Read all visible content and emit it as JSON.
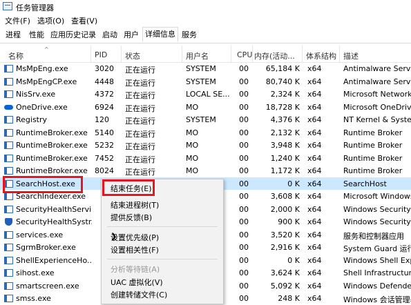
{
  "window": {
    "title": "任务管理器"
  },
  "menu": [
    "文件(F)",
    "选项(O)",
    "查看(V)"
  ],
  "tabs": [
    "进程",
    "性能",
    "应用历史记录",
    "启动",
    "用户",
    "详细信息",
    "服务"
  ],
  "columns": [
    "名称",
    "PID",
    "状态",
    "用户名",
    "CPU",
    "内存(活动...",
    "体系结构",
    "描述"
  ],
  "rows": [
    {
      "name": "MsMpEng.exe",
      "pid": "3020",
      "status": "正在运行",
      "user": "SYSTEM",
      "cpu": "00",
      "mem": "65,184 K",
      "arch": "x64",
      "desc": "Antimalware Service",
      "icon": "app"
    },
    {
      "name": "MsMpEngCP.exe",
      "pid": "4448",
      "status": "正在运行",
      "user": "SYSTEM",
      "cpu": "00",
      "mem": "80,740 K",
      "arch": "x64",
      "desc": "Antimalware Service",
      "icon": "app"
    },
    {
      "name": "NisSrv.exe",
      "pid": "4372",
      "status": "正在运行",
      "user": "LOCAL SE...",
      "cpu": "00",
      "mem": "2,324 K",
      "arch": "x64",
      "desc": "Microsoft Network",
      "icon": "app"
    },
    {
      "name": "OneDrive.exe",
      "pid": "6924",
      "status": "正在运行",
      "user": "MO",
      "cpu": "00",
      "mem": "18,728 K",
      "arch": "x64",
      "desc": "Microsoft OneDrive",
      "icon": "cloud"
    },
    {
      "name": "Registry",
      "pid": "120",
      "status": "正在运行",
      "user": "SYSTEM",
      "cpu": "00",
      "mem": "4,376 K",
      "arch": "x64",
      "desc": "NT Kernel & System",
      "icon": "app"
    },
    {
      "name": "RuntimeBroker.exe",
      "pid": "5140",
      "status": "正在运行",
      "user": "MO",
      "cpu": "00",
      "mem": "2,132 K",
      "arch": "x64",
      "desc": "Runtime Broker",
      "icon": "app"
    },
    {
      "name": "RuntimeBroker.exe",
      "pid": "5232",
      "status": "正在运行",
      "user": "MO",
      "cpu": "00",
      "mem": "3,948 K",
      "arch": "x64",
      "desc": "Runtime Broker",
      "icon": "app"
    },
    {
      "name": "RuntimeBroker.exe",
      "pid": "7452",
      "status": "正在运行",
      "user": "MO",
      "cpu": "00",
      "mem": "1,240 K",
      "arch": "x64",
      "desc": "Runtime Broker",
      "icon": "app"
    },
    {
      "name": "RuntimeBroker.exe",
      "pid": "8024",
      "status": "正在运行",
      "user": "MO",
      "cpu": "00",
      "mem": "1,172 K",
      "arch": "x64",
      "desc": "Runtime Broker",
      "icon": "app"
    },
    {
      "name": "SearchHost.exe",
      "pid": "",
      "status": "",
      "user": "",
      "cpu": "00",
      "mem": "0 K",
      "arch": "x64",
      "desc": "SearchHost",
      "icon": "app"
    },
    {
      "name": "SearchIndexer.exe",
      "pid": "",
      "status": "",
      "user": "",
      "cpu": "00",
      "mem": "3,608 K",
      "arch": "x64",
      "desc": "Microsoft Windows",
      "icon": "app"
    },
    {
      "name": "SecurityHealthServi...",
      "pid": "",
      "status": "",
      "user": "",
      "cpu": "00",
      "mem": "2,000 K",
      "arch": "x64",
      "desc": "Windows Security H",
      "icon": "app"
    },
    {
      "name": "SecurityHealthSystr...",
      "pid": "",
      "status": "",
      "user": "",
      "cpu": "00",
      "mem": "900 K",
      "arch": "x64",
      "desc": "Windows Security n",
      "icon": "shield"
    },
    {
      "name": "services.exe",
      "pid": "",
      "status": "",
      "user": "",
      "cpu": "00",
      "mem": "3,520 K",
      "arch": "x64",
      "desc": "服务和控制器应用",
      "icon": "app"
    },
    {
      "name": "SgrmBroker.exe",
      "pid": "",
      "status": "",
      "user": "",
      "cpu": "00",
      "mem": "2,916 K",
      "arch": "x64",
      "desc": "System Guard 运行时",
      "icon": "app"
    },
    {
      "name": "ShellExperienceHo...",
      "pid": "",
      "status": "",
      "user": "",
      "cpu": "00",
      "mem": "0 K",
      "arch": "x64",
      "desc": "Windows Shell Expe",
      "icon": "app"
    },
    {
      "name": "sihost.exe",
      "pid": "",
      "status": "",
      "user": "",
      "cpu": "00",
      "mem": "3,624 K",
      "arch": "x64",
      "desc": "Shell Infrastructure",
      "icon": "app"
    },
    {
      "name": "smartscreen.exe",
      "pid": "",
      "status": "",
      "user": "",
      "cpu": "00",
      "mem": "5,092 K",
      "arch": "x64",
      "desc": "Windows Defender",
      "icon": "app"
    },
    {
      "name": "smss.exe",
      "pid": "",
      "status": "",
      "user": "",
      "cpu": "00",
      "mem": "248 K",
      "arch": "x64",
      "desc": "Windows 会话管理器",
      "icon": "app"
    }
  ],
  "selected_row": 9,
  "context_menu": {
    "items": [
      {
        "label": "结束任务(E)",
        "enabled": true
      },
      {
        "label": "结束进程树(T)",
        "enabled": true
      },
      {
        "label": "提供反馈(B)",
        "enabled": true
      },
      {
        "label": "设置优先级(P)",
        "enabled": true,
        "submenu": true
      },
      {
        "label": "设置相关性(F)",
        "enabled": true
      },
      {
        "label": "分析等待链(A)",
        "enabled": false
      },
      {
        "label": "UAC 虚拟化(V)",
        "enabled": true
      },
      {
        "label": "创建转储文件(C)",
        "enabled": true
      }
    ]
  },
  "colors": {
    "selection": "#cce8ff",
    "highlight": "#e8141e"
  }
}
